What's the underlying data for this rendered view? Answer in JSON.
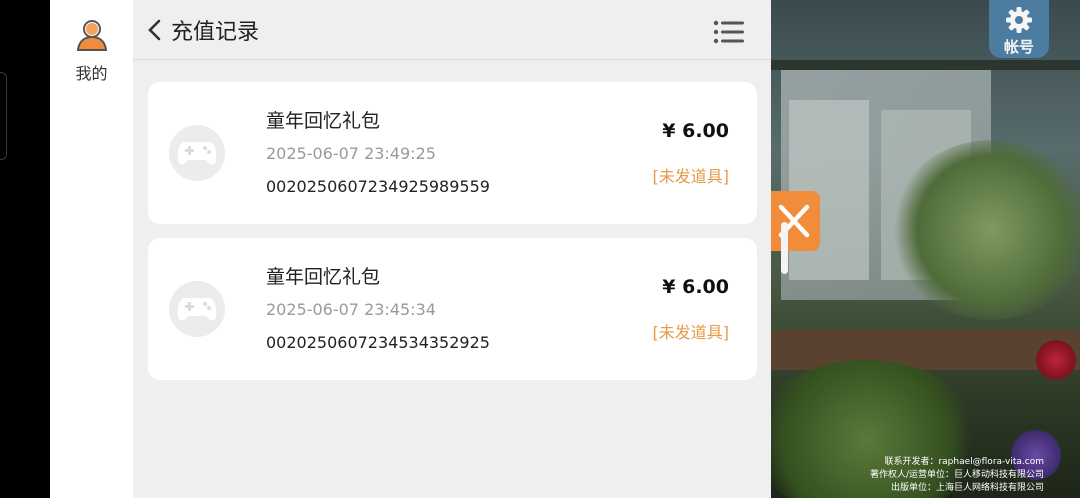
{
  "nav": {
    "me_label": "我的"
  },
  "header": {
    "title": "充值记录"
  },
  "records": [
    {
      "name": "童年回忆礼包",
      "time": "2025-06-07 23:49:25",
      "order_no": "002025060723492598955​9",
      "price": "¥ 6.00",
      "status": "[未发道具]"
    },
    {
      "name": "童年回忆礼包",
      "time": "2025-06-07 23:45:34",
      "order_no": "0020250607234534352925",
      "price": "¥ 6.00",
      "status": "[未发道具]"
    }
  ],
  "game": {
    "account_label": "帐号",
    "copyright": [
      "联系开发者：raphael@flora-vita.com",
      "著作权人/运营单位：巨人移动科技有限公司",
      "出版单位：上海巨人网络科技有限公司"
    ]
  },
  "colors": {
    "status": "#e69a4a",
    "accent": "#f08c3a",
    "account": "#4e7fa6"
  },
  "icons": [
    "user-icon",
    "back-arrow-icon",
    "menu-list-icon",
    "gamepad-icon",
    "gear-icon",
    "close-icon"
  ]
}
